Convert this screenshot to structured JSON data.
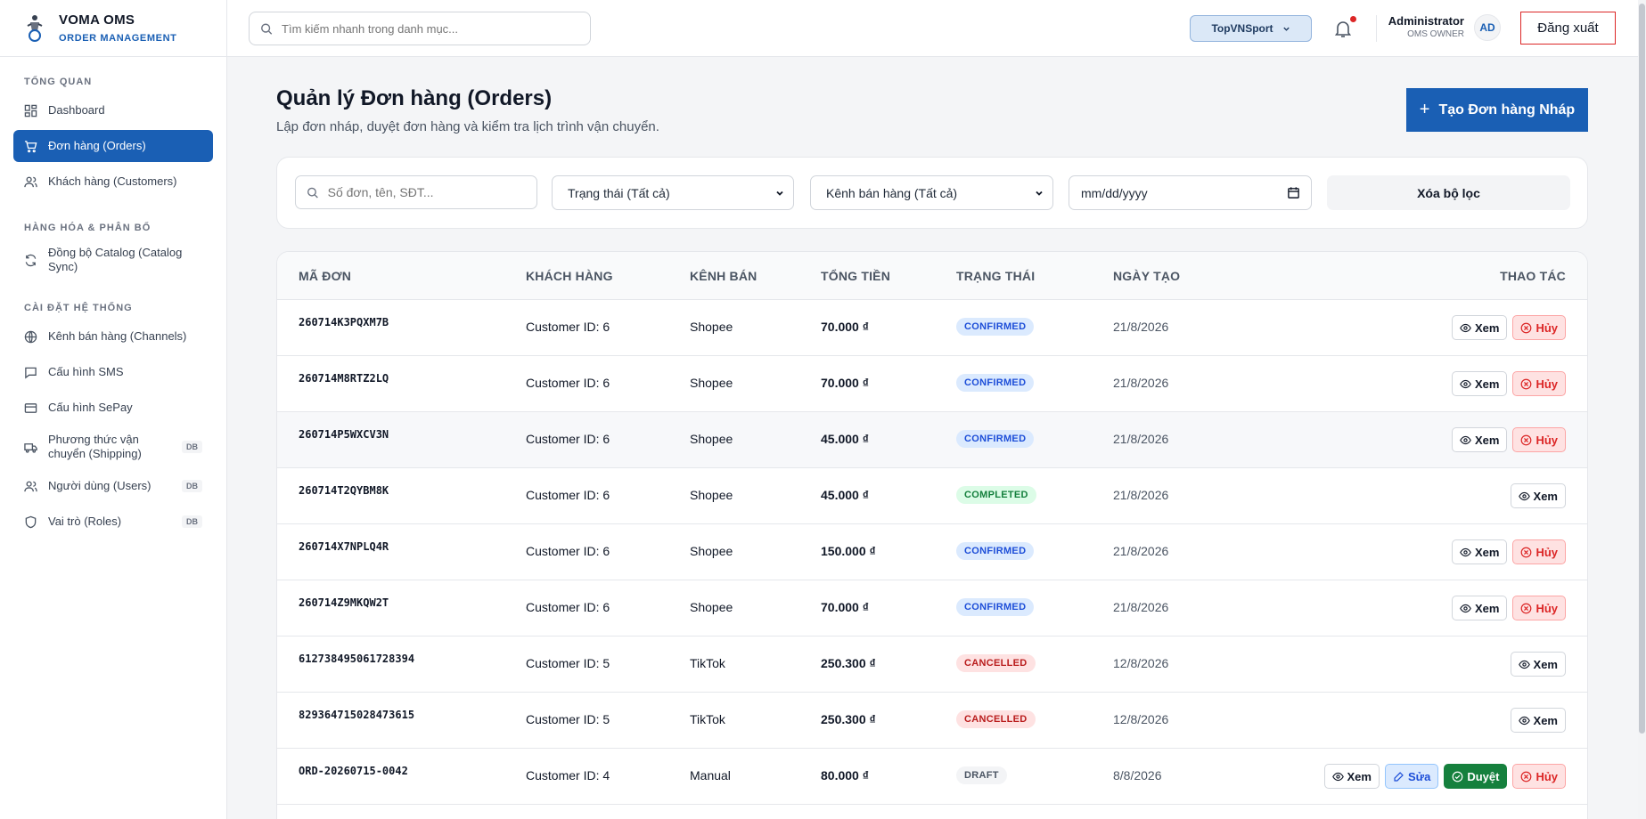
{
  "brand": {
    "name": "VOMA OMS",
    "subtitle": "ORDER MANAGEMENT"
  },
  "sidebar": {
    "sections": [
      {
        "title": "TỔNG QUAN",
        "items": [
          {
            "label": "Dashboard",
            "icon": "dashboard-icon"
          },
          {
            "label": "Đơn hàng (Orders)",
            "icon": "cart-icon",
            "active": true
          },
          {
            "label": "Khách hàng (Customers)",
            "icon": "users-icon"
          }
        ]
      },
      {
        "title": "HÀNG HÓA & PHÂN BỔ",
        "items": [
          {
            "label": "Đồng bộ Catalog (Catalog Sync)",
            "icon": "sync-icon"
          }
        ]
      },
      {
        "title": "CÀI ĐẶT HỆ THỐNG",
        "items": [
          {
            "label": "Kênh bán hàng (Channels)",
            "icon": "globe-icon"
          },
          {
            "label": "Cấu hình SMS",
            "icon": "message-icon"
          },
          {
            "label": "Cấu hình SePay",
            "icon": "card-icon"
          },
          {
            "label": "Phương thức vận chuyển (Shipping)",
            "icon": "truck-icon",
            "badge": "DB"
          },
          {
            "label": "Người dùng (Users)",
            "icon": "users-icon",
            "badge": "DB"
          },
          {
            "label": "Vai trò (Roles)",
            "icon": "shield-icon",
            "badge": "DB"
          }
        ]
      }
    ]
  },
  "topbar": {
    "search_placeholder": "Tìm kiếm nhanh trong danh mục...",
    "shop": "TopVNSport",
    "user_name": "Administrator",
    "user_role": "OMS OWNER",
    "avatar": "AD",
    "logout": "Đăng xuất"
  },
  "page": {
    "title": "Quản lý Đơn hàng (Orders)",
    "subtitle": "Lập đơn nháp, duyệt đơn hàng và kiểm tra lịch trình vận chuyển.",
    "create_button": "Tạo Đơn hàng Nháp"
  },
  "filters": {
    "search_placeholder": "Số đơn, tên, SĐT...",
    "status": "Trạng thái (Tất cả)",
    "channel": "Kênh bán hàng (Tất cả)",
    "date_placeholder": "mm/dd/yyyy",
    "clear": "Xóa bộ lọc"
  },
  "table": {
    "headers": {
      "id": "MÃ ĐƠN",
      "customer": "KHÁCH HÀNG",
      "channel": "KÊNH BÁN",
      "total": "TỔNG TIỀN",
      "status": "TRẠNG THÁI",
      "date": "NGÀY TẠO",
      "actions": "THAO TÁC"
    },
    "labels": {
      "view": "Xem",
      "edit": "Sửa",
      "approve": "Duyệt",
      "cancel": "Hủy"
    },
    "rows": [
      {
        "id": "260714K3PQXM7B",
        "customer": "Customer ID: 6",
        "channel": "Shopee",
        "total": "70.000 ₫",
        "status": "CONFIRMED",
        "date": "21/8/2026",
        "actions": [
          "view",
          "cancel"
        ]
      },
      {
        "id": "260714M8RTZ2LQ",
        "customer": "Customer ID: 6",
        "channel": "Shopee",
        "total": "70.000 ₫",
        "status": "CONFIRMED",
        "date": "21/8/2026",
        "actions": [
          "view",
          "cancel"
        ]
      },
      {
        "id": "260714P5WXCV3N",
        "customer": "Customer ID: 6",
        "channel": "Shopee",
        "total": "45.000 ₫",
        "status": "CONFIRMED",
        "date": "21/8/2026",
        "actions": [
          "view",
          "cancel"
        ],
        "highlight": true
      },
      {
        "id": "260714T2QYBM8K",
        "customer": "Customer ID: 6",
        "channel": "Shopee",
        "total": "45.000 ₫",
        "status": "COMPLETED",
        "date": "21/8/2026",
        "actions": [
          "view"
        ]
      },
      {
        "id": "260714X7NPLQ4R",
        "customer": "Customer ID: 6",
        "channel": "Shopee",
        "total": "150.000 ₫",
        "status": "CONFIRMED",
        "date": "21/8/2026",
        "actions": [
          "view",
          "cancel"
        ]
      },
      {
        "id": "260714Z9MKQW2T",
        "customer": "Customer ID: 6",
        "channel": "Shopee",
        "total": "70.000 ₫",
        "status": "CONFIRMED",
        "date": "21/8/2026",
        "actions": [
          "view",
          "cancel"
        ]
      },
      {
        "id": "612738495061728394",
        "customer": "Customer ID: 5",
        "channel": "TikTok",
        "total": "250.300 ₫",
        "status": "CANCELLED",
        "date": "12/8/2026",
        "actions": [
          "view"
        ]
      },
      {
        "id": "829364715028473615",
        "customer": "Customer ID: 5",
        "channel": "TikTok",
        "total": "250.300 ₫",
        "status": "CANCELLED",
        "date": "12/8/2026",
        "actions": [
          "view"
        ]
      },
      {
        "id": "ORD-20260715-0042",
        "customer": "Customer ID: 4",
        "channel": "Manual",
        "total": "80.000 ₫",
        "status": "DRAFT",
        "date": "8/8/2026",
        "actions": [
          "view",
          "edit",
          "approve",
          "cancel"
        ]
      }
    ]
  }
}
